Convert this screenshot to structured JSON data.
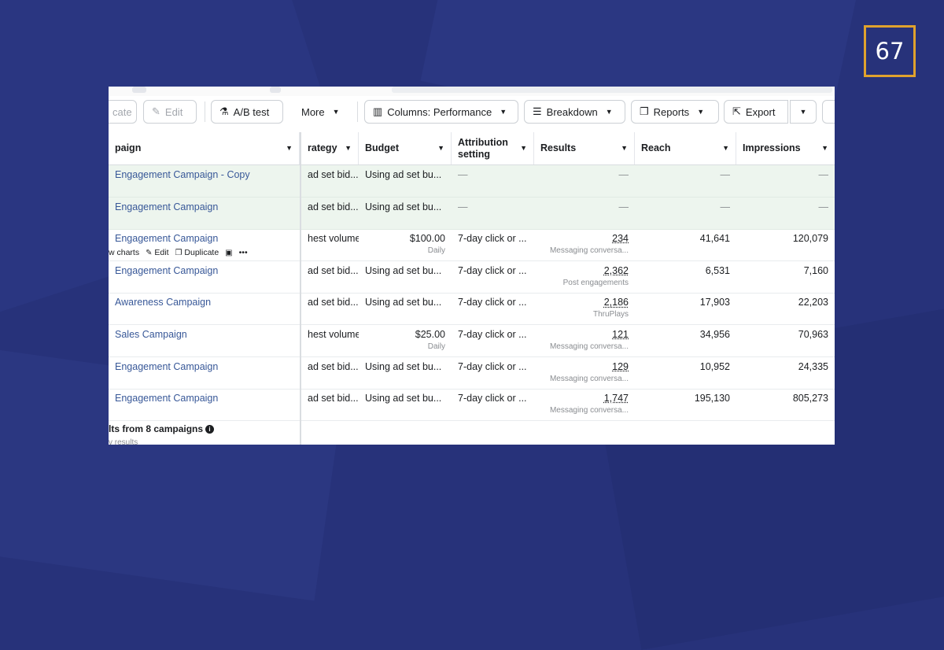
{
  "slide": {
    "page_number": "67",
    "accent_color": "#e0a22d",
    "background_color": "#27327a"
  },
  "toolbar": {
    "duplicate_label": "cate",
    "edit_label": "Edit",
    "ab_test_label": "A/B test",
    "more_label": "More",
    "columns_label": "Columns: Performance",
    "breakdown_label": "Breakdown",
    "reports_label": "Reports",
    "export_label": "Export",
    "icons": [
      "pencil-icon",
      "flask-icon",
      "columns-icon",
      "breakdown-icon",
      "reports-icon",
      "export-icon"
    ]
  },
  "table": {
    "headers": {
      "campaign": "paign",
      "strategy": "rategy",
      "budget": "Budget",
      "attribution": "Attribution setting",
      "results": "Results",
      "reach": "Reach",
      "impressions": "Impressions"
    },
    "rows": [
      {
        "name": "Engagement Campaign - Copy",
        "strategy": "ad set bid...",
        "budget": "Using ad set bu...",
        "budget_sub": "",
        "attribution": "—",
        "results": "—",
        "results_sub": "",
        "reach": "—",
        "impressions": "—",
        "highlight": true
      },
      {
        "name": "Engagement Campaign",
        "strategy": "ad set bid...",
        "budget": "Using ad set bu...",
        "budget_sub": "",
        "attribution": "—",
        "results": "—",
        "results_sub": "",
        "reach": "—",
        "impressions": "—",
        "highlight": true
      },
      {
        "name": "Engagement Campaign",
        "strategy": "hest volume",
        "budget": "$100.00",
        "budget_sub": "Daily",
        "attribution": "7-day click or ...",
        "results": "234",
        "results_sub": "Messaging conversa...",
        "reach": "41,641",
        "impressions": "120,079",
        "highlight": false
      },
      {
        "name": "Engagement Campaign",
        "strategy": "ad set bid...",
        "budget": "Using ad set bu...",
        "budget_sub": "",
        "attribution": "7-day click or ...",
        "results": "2,362",
        "results_sub": "Post engagements",
        "reach": "6,531",
        "impressions": "7,160",
        "highlight": false
      },
      {
        "name": "Awareness Campaign",
        "strategy": "ad set bid...",
        "budget": "Using ad set bu...",
        "budget_sub": "",
        "attribution": "7-day click or ...",
        "results": "2,186",
        "results_sub": "ThruPlays",
        "reach": "17,903",
        "impressions": "22,203",
        "highlight": false
      },
      {
        "name": "Sales Campaign",
        "strategy": "hest volume",
        "budget": "$25.00",
        "budget_sub": "Daily",
        "attribution": "7-day click or ...",
        "results": "121",
        "results_sub": "Messaging conversa...",
        "reach": "34,956",
        "impressions": "70,963",
        "highlight": false
      },
      {
        "name": "Engagement Campaign",
        "strategy": "ad set bid...",
        "budget": "Using ad set bu...",
        "budget_sub": "",
        "attribution": "7-day click or ...",
        "results": "129",
        "results_sub": "Messaging conversa...",
        "reach": "10,952",
        "impressions": "24,335",
        "highlight": false
      },
      {
        "name": "Engagement Campaign",
        "strategy": "ad set bid...",
        "budget": "Using ad set bu...",
        "budget_sub": "",
        "attribution": "7-day click or ...",
        "results": "1,747",
        "results_sub": "Messaging conversa...",
        "reach": "195,130",
        "impressions": "805,273",
        "highlight": false
      }
    ],
    "row_actions": {
      "charts": "w charts",
      "edit": "Edit",
      "duplicate": "Duplicate",
      "more": "•••"
    },
    "footer": "lts from 8 campaigns",
    "footer_sub": "v results"
  }
}
